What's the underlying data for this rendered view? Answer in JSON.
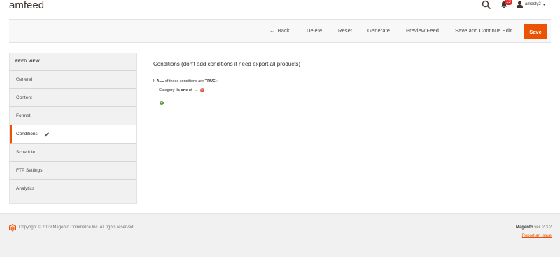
{
  "header": {
    "title": "amfeed",
    "notifications_count": "13",
    "user_name": "amasty2",
    "user_caret": "▾"
  },
  "toolbar": {
    "back_label": "Back",
    "back_arrow": "←",
    "delete_label": "Delete",
    "reset_label": "Reset",
    "generate_label": "Generate",
    "preview_label": "Preview Feed",
    "save_continue_label": "Save and Continue Edit",
    "save_label": "Save",
    "accent_color": "#eb5202"
  },
  "sidebar": {
    "title": "FEED VIEW",
    "items": [
      {
        "label": "General",
        "active": false
      },
      {
        "label": "Content",
        "active": false
      },
      {
        "label": "Format",
        "active": false
      },
      {
        "label": "Conditions",
        "active": true
      },
      {
        "label": "Schedule",
        "active": false
      },
      {
        "label": "FTP Settings",
        "active": false
      },
      {
        "label": "Analytics",
        "active": false
      }
    ]
  },
  "main": {
    "section_title": "Conditions (don't add conditions if need export all products)",
    "cond_if": "If",
    "cond_aggregator": "ALL",
    "cond_middle": "of these conditions are",
    "cond_value": "TRUE",
    "cond_end": ":",
    "rule_attribute": "Category",
    "rule_operator": "is one of",
    "rule_value": "...",
    "remove_icon": "remove-icon",
    "add_icon": "add-condition-icon"
  },
  "footer": {
    "copyright": "Copyright © 2019 Magento Commerce Inc. All rights reserved.",
    "product": "Magento",
    "version": "ver. 2.3.2",
    "report_link": "Report an Issue"
  }
}
